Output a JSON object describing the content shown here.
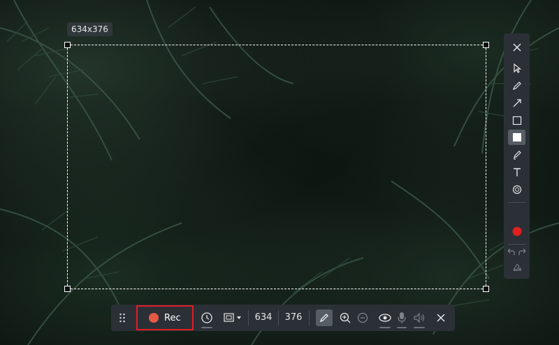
{
  "selection": {
    "size_label": "634x376"
  },
  "side_tools": [
    {
      "name": "close-icon",
      "interactable": true
    },
    {
      "name": "select-arrow-icon",
      "interactable": true
    },
    {
      "name": "pen-icon",
      "interactable": true
    },
    {
      "name": "arrow-line-icon",
      "interactable": true
    },
    {
      "name": "rectangle-outline-icon",
      "interactable": true
    },
    {
      "name": "filled-rectangle-icon",
      "interactable": true
    },
    {
      "name": "highlighter-icon",
      "interactable": true
    },
    {
      "name": "text-icon",
      "interactable": true
    },
    {
      "name": "blur-icon",
      "interactable": true
    },
    {
      "name": "color-picker-icon",
      "interactable": true
    },
    {
      "name": "undo-icon",
      "interactable": true
    },
    {
      "name": "redo-icon",
      "interactable": true
    },
    {
      "name": "clear-icon",
      "interactable": true
    }
  ],
  "colors": {
    "record_red": "#e55a45",
    "highlight_border": "#e01d25",
    "panel_bg": "#2b3036"
  },
  "toolbar": {
    "rec_label": "Rec",
    "width_value": "634",
    "height_value": "376"
  }
}
